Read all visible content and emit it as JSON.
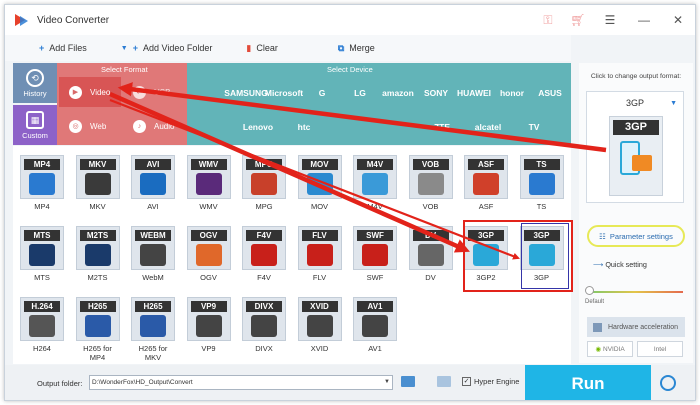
{
  "window": {
    "title": "Video Converter"
  },
  "toolbar": {
    "add_files": "Add Files",
    "add_video_folder": "Add Video Folder",
    "clear": "Clear",
    "merge": "Merge"
  },
  "sidebar": {
    "history": "History",
    "custom": "Custom"
  },
  "select_format": {
    "label": "Select Format",
    "video": "Video",
    "usb": "USB",
    "web": "Web",
    "audio": "Audio"
  },
  "select_device": {
    "label": "Select Device",
    "row1": [
      "",
      "SAMSUNG",
      "Microsoft",
      "G",
      "LG",
      "amazon",
      "SONY",
      "HUAWEI",
      "honor",
      "ASUS"
    ],
    "row2": [
      "",
      "Lenovo",
      "htc",
      "",
      "",
      "ZTE",
      "alcatel",
      "TV"
    ]
  },
  "formats": [
    {
      "badge": "MP4",
      "label": "MP4",
      "color": "#2a7ad0"
    },
    {
      "badge": "MKV",
      "label": "MKV",
      "color": "#3a3a3a"
    },
    {
      "badge": "AVI",
      "label": "AVI",
      "color": "#1a6cc0"
    },
    {
      "badge": "WMV",
      "label": "WMV",
      "color": "#5a2a7a"
    },
    {
      "badge": "MPG",
      "label": "MPG",
      "color": "#c8402a"
    },
    {
      "badge": "MOV",
      "label": "MOV",
      "color": "#2a8ad0"
    },
    {
      "badge": "M4V",
      "label": "M4V",
      "color": "#3a9ad8"
    },
    {
      "badge": "VOB",
      "label": "VOB",
      "color": "#8a8a8a"
    },
    {
      "badge": "ASF",
      "label": "ASF",
      "color": "#d0402a"
    },
    {
      "badge": "TS",
      "label": "TS",
      "color": "#2a7ad0"
    },
    {
      "badge": "MTS",
      "label": "MTS",
      "color": "#1a3a6a"
    },
    {
      "badge": "M2TS",
      "label": "M2TS",
      "color": "#1a3a6a"
    },
    {
      "badge": "WEBM",
      "label": "WebM",
      "color": "#444"
    },
    {
      "badge": "OGV",
      "label": "OGV",
      "color": "#e0682a"
    },
    {
      "badge": "F4V",
      "label": "F4V",
      "color": "#c8201a"
    },
    {
      "badge": "FLV",
      "label": "FLV",
      "color": "#c8201a"
    },
    {
      "badge": "SWF",
      "label": "SWF",
      "color": "#c8201a"
    },
    {
      "badge": "DV",
      "label": "DV",
      "color": "#666"
    },
    {
      "badge": "3GP",
      "label": "3GP2",
      "color": "#2aa8d8"
    },
    {
      "badge": "3GP",
      "label": "3GP",
      "color": "#2aa8d8"
    },
    {
      "badge": "H.264",
      "label": "H264",
      "color": "#555"
    },
    {
      "badge": "H265",
      "label": "H265 for MP4",
      "color": "#2a5aa8"
    },
    {
      "badge": "H265",
      "label": "H265 for MKV",
      "color": "#2a5aa8"
    },
    {
      "badge": "VP9",
      "label": "VP9",
      "color": "#444"
    },
    {
      "badge": "DIVX",
      "label": "DIVX",
      "color": "#444"
    },
    {
      "badge": "XVID",
      "label": "XVID",
      "color": "#444"
    },
    {
      "badge": "AV1",
      "label": "AV1",
      "color": "#444"
    }
  ],
  "right_panel": {
    "hint": "Click to change output format:",
    "selected_format": "3GP",
    "selected_badge": "3GP",
    "parameter_settings": "Parameter settings",
    "quick_setting": "Quick setting",
    "default_label": "Default",
    "hardware_acceleration": "Hardware acceleration",
    "nvidia": "NVIDIA",
    "intel": "Intel"
  },
  "bottom": {
    "output_folder_label": "Output folder:",
    "output_folder_value": "D:\\WonderFox\\HD_Output\\Convert",
    "hyper_engine": "Hyper Engine",
    "run": "Run"
  },
  "colors": {
    "accent": "#1fb5e6",
    "highlight": "#e2231a",
    "format_panel": "#e07878",
    "device_panel": "#62b4b8"
  }
}
